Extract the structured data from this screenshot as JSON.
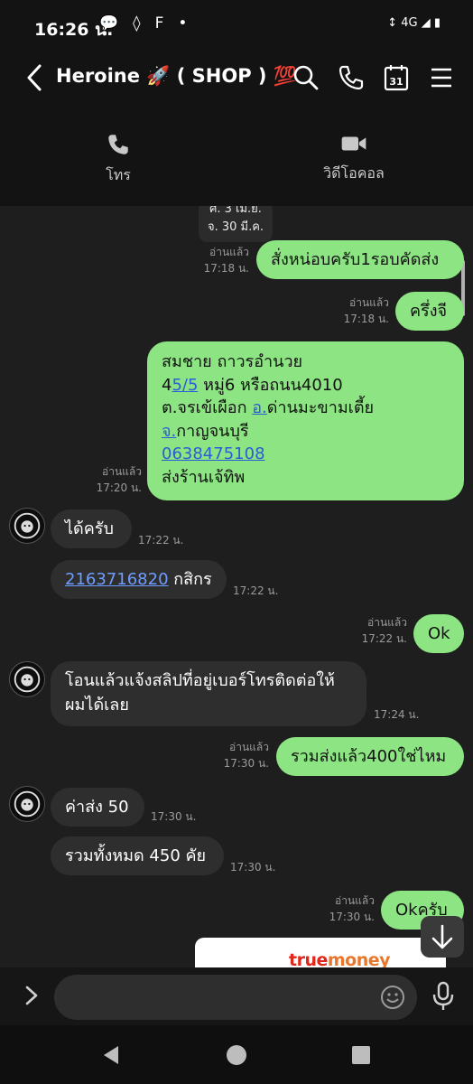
{
  "status_bar": {
    "time": "16:26 น.",
    "network": "4G"
  },
  "header": {
    "title": "Heroine 🚀 ( SHOP ) 💯",
    "calendar_day": "31"
  },
  "call_actions": {
    "voice_label": "โทร",
    "video_label": "วิดีโอคอล"
  },
  "date_divider": {
    "line1": "ศ. 3 เม.ย.",
    "line2": "จ. 30 มี.ค."
  },
  "messages": [
    {
      "dir": "out",
      "read": "อ่านแล้ว",
      "time": "17:18 น.",
      "text": "สั่งหน่อบครับ1รอบคัดส่ง"
    },
    {
      "dir": "out",
      "read": "อ่านแล้ว",
      "time": "17:18 น.",
      "text": "ครึ่งจี"
    },
    {
      "dir": "out",
      "read": "อ่านแล้ว",
      "time": "17:20 น.",
      "address": {
        "name": "สมชาย ถาวรอำนวย",
        "house_prefix": "4",
        "house_link": "5/5",
        "house_rest": " หมู่6 หรือถนน4010",
        "sub_prefix": "ต.จรเข้เผือก ",
        "amphoe_link": "อ.",
        "amphoe_rest": "ด่านมะขามเตี้ย",
        "province_link": "จ.",
        "province_rest": "กาญจนบุรี",
        "phone": "0638475108",
        "note": "ส่งร้านเจ้ทิพ"
      }
    },
    {
      "dir": "in",
      "time": "17:22 น.",
      "text": "ได้ครับ"
    },
    {
      "dir": "in",
      "time": "17:22 น.",
      "account_number": "2163716820",
      "bank": " กสิกร"
    },
    {
      "dir": "out",
      "read": "อ่านแล้ว",
      "time": "17:22 น.",
      "text": "Ok"
    },
    {
      "dir": "in",
      "time": "17:24 น.",
      "line1": "โอนแล้วแจ้งสลิปที่อยู่เบอร์โทรติดต่อให้",
      "line2": "ผมได้เลย"
    },
    {
      "dir": "out",
      "read": "อ่านแล้ว",
      "time": "17:30 น.",
      "text": "รวมส่งแล้ว400ใช่ไหม"
    },
    {
      "dir": "in",
      "time": "17:30 น.",
      "text": "ค่าส่ง 50"
    },
    {
      "dir": "in",
      "time": "17:30 น.",
      "text": "รวมทั้งหมด 450 คัย"
    },
    {
      "dir": "out",
      "read": "อ่านแล้ว",
      "time": "17:30 น.",
      "text": "Okครับ"
    }
  ],
  "attachment": {
    "brand_a": "true",
    "brand_b": "money"
  },
  "input": {
    "placeholder": ""
  },
  "colors": {
    "outgoing_bubble": "#8de482",
    "incoming_bubble": "#2e2e2e",
    "background": "#1e1e1e"
  }
}
